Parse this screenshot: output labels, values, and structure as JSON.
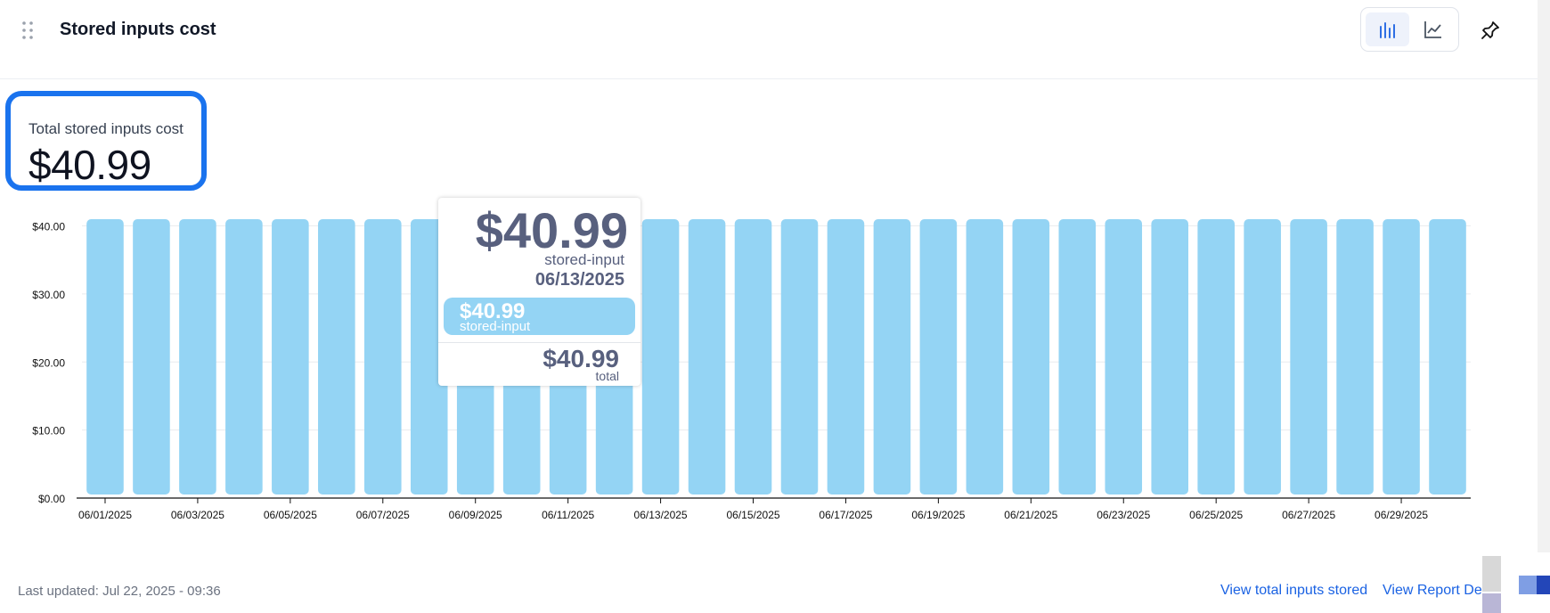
{
  "header": {
    "title": "Stored inputs cost",
    "icons": {
      "drag": "drag-handle-icon",
      "bar_view": "bar-chart-icon",
      "line_view": "line-chart-icon",
      "pin": "pin-icon"
    },
    "active_view": "bar"
  },
  "summary": {
    "label": "Total stored inputs cost",
    "value": "$40.99"
  },
  "chart_data": {
    "type": "bar",
    "categories": [
      "06/01/2025",
      "06/02/2025",
      "06/03/2025",
      "06/04/2025",
      "06/05/2025",
      "06/06/2025",
      "06/07/2025",
      "06/08/2025",
      "06/09/2025",
      "06/10/2025",
      "06/11/2025",
      "06/12/2025",
      "06/13/2025",
      "06/14/2025",
      "06/15/2025",
      "06/16/2025",
      "06/17/2025",
      "06/18/2025",
      "06/19/2025",
      "06/20/2025",
      "06/21/2025",
      "06/22/2025",
      "06/23/2025",
      "06/24/2025",
      "06/25/2025",
      "06/26/2025",
      "06/27/2025",
      "06/28/2025",
      "06/29/2025",
      "06/30/2025"
    ],
    "x_tick_labels": [
      "06/01/2025",
      "06/03/2025",
      "06/05/2025",
      "06/07/2025",
      "06/09/2025",
      "06/11/2025",
      "06/13/2025",
      "06/15/2025",
      "06/17/2025",
      "06/19/2025",
      "06/21/2025",
      "06/23/2025",
      "06/25/2025",
      "06/27/2025",
      "06/29/2025"
    ],
    "series": [
      {
        "name": "stored-input",
        "values": [
          40.99,
          40.99,
          40.99,
          40.99,
          40.99,
          40.99,
          40.99,
          40.99,
          40.99,
          40.99,
          40.99,
          40.99,
          40.99,
          40.99,
          40.99,
          40.99,
          40.99,
          40.99,
          40.99,
          40.99,
          40.99,
          40.99,
          40.99,
          40.99,
          40.99,
          40.99,
          40.99,
          40.99,
          40.99,
          40.99
        ]
      }
    ],
    "ylim": [
      0,
      40.99
    ],
    "y_ticks": [
      {
        "value": 0,
        "label": "$0.00"
      },
      {
        "value": 10,
        "label": "$10.00"
      },
      {
        "value": 20,
        "label": "$20.00"
      },
      {
        "value": 30,
        "label": "$30.00"
      },
      {
        "value": 40,
        "label": "$40.00"
      }
    ],
    "grid": true,
    "title": "",
    "xlabel": "",
    "ylabel": "",
    "bar_color": "#94d4f4",
    "hovered_index": 12
  },
  "tooltip": {
    "value": "$40.99",
    "series": "stored-input",
    "date": "06/13/2025",
    "pill_value": "$40.99",
    "pill_series": "stored-input",
    "total_value": "$40.99",
    "total_label": "total"
  },
  "footer": {
    "last_updated": "Last updated: Jul 22, 2025 - 09:36",
    "link_inputs": "View total inputs stored",
    "link_report": "View Report De"
  },
  "colors": {
    "accent": "#1a73ee",
    "link": "#1a62e3",
    "bar": "#94d4f4",
    "tooltip_text": "#58607e"
  }
}
